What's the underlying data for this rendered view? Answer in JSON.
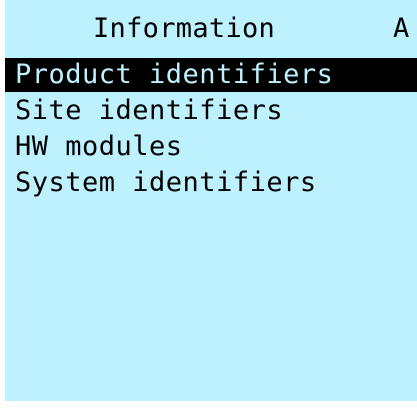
{
  "header": {
    "title": "Information",
    "flag": "A"
  },
  "menu": {
    "items": [
      {
        "label": "Product identifiers",
        "selected": true
      },
      {
        "label": "Site identifiers",
        "selected": false
      },
      {
        "label": "HW modules",
        "selected": false
      },
      {
        "label": "System identifiers",
        "selected": false
      }
    ]
  },
  "colors": {
    "screen_background": "#bdf1fd",
    "text": "#000000",
    "selection_background": "#000000",
    "selection_text": "#bdf1fd"
  }
}
